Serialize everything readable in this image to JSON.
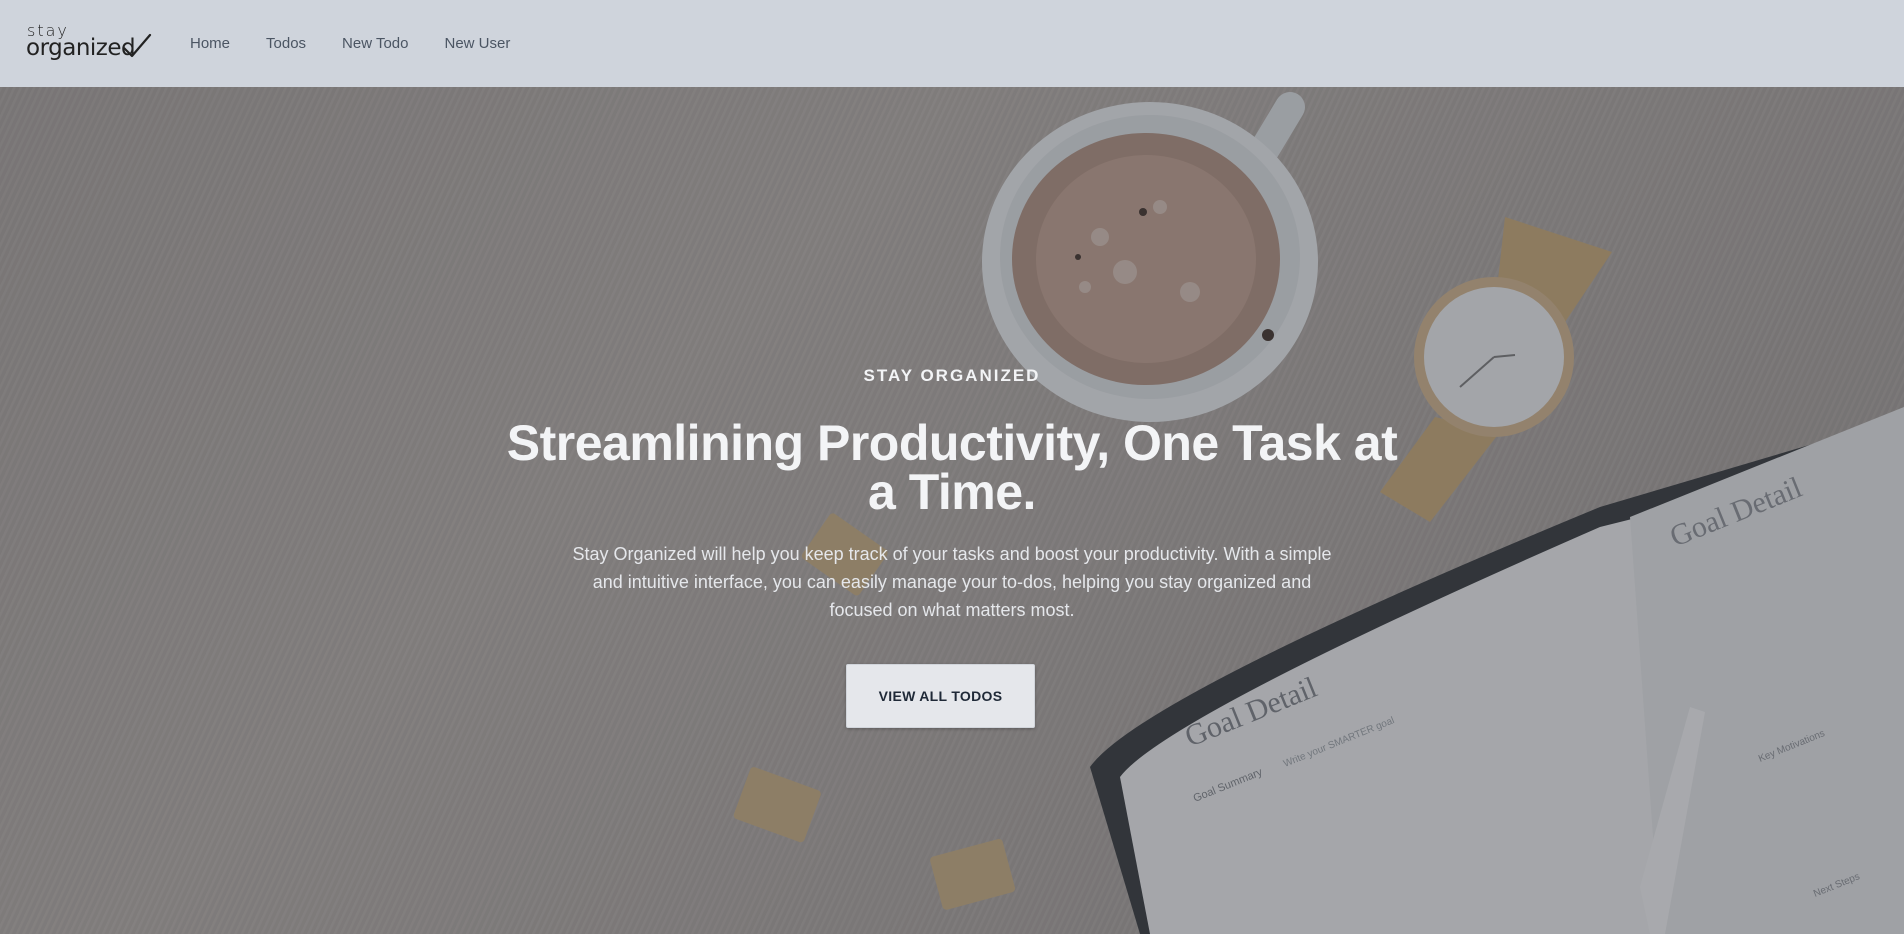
{
  "brand": {
    "line1": "stay",
    "line2": "organized"
  },
  "nav": {
    "items": [
      "Home",
      "Todos",
      "New Todo",
      "New User"
    ]
  },
  "hero": {
    "eyebrow": "STAY ORGANIZED",
    "headline": "Streamlining Productivity, One Task at a Time.",
    "description": "Stay Organized will help you keep track of your tasks and boost your productivity. With a simple and intuitive interface, you can easily manage your to-dos, helping you stay organized and focused on what matters most.",
    "cta_label": "VIEW ALL TODOS",
    "notebook_heading": "Goal Detail",
    "notebook_subheading": "Goal Summary",
    "notebook_prompt": "Write your SMARTER goal",
    "notebook_page2_label": "Key Motivations",
    "notebook_page2_label2": "Next Steps"
  },
  "colors": {
    "header_bg": "#cfd4dc",
    "nav_text": "#4b5563",
    "cta_bg": "#e5e7eb",
    "cta_text": "#1f2937"
  }
}
